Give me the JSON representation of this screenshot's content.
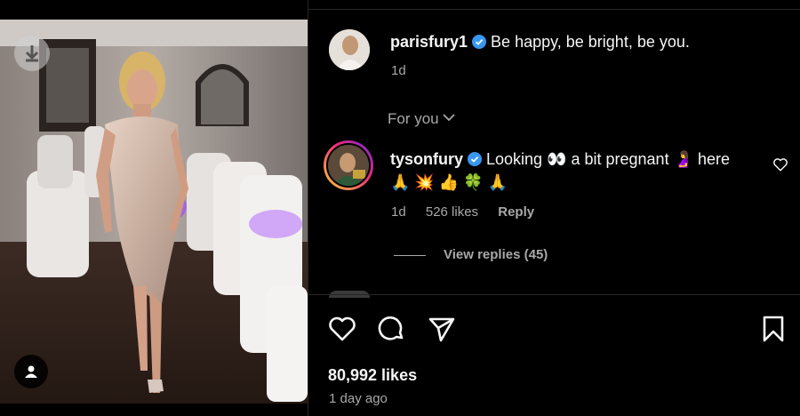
{
  "caption": {
    "username": "parisfury1",
    "text": "Be happy, be bright, be you.",
    "time": "1d"
  },
  "for_you_label": "For you",
  "comment": {
    "username": "tysonfury",
    "text_line1": "Looking 👀 a bit pregnant 🤰 here",
    "text_line2": "🙏 💥 👍 🍀 🙏",
    "time": "1d",
    "likes": "526 likes",
    "reply_label": "Reply",
    "view_replies": "View replies (45)"
  },
  "post": {
    "likes": "80,992 likes",
    "posted": "1 day ago"
  },
  "icons": {
    "verified_color": "#3897f0",
    "ring_gradient": [
      "#f9ce34",
      "#ee2a7b",
      "#6228d7"
    ]
  }
}
